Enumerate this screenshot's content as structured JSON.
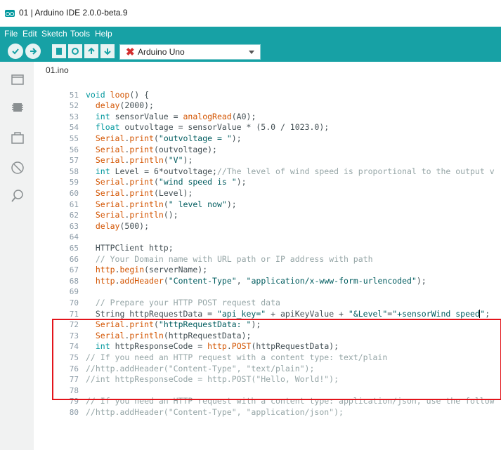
{
  "window": {
    "title": "01 | Arduino IDE 2.0.0-beta.9"
  },
  "menu": {
    "items": [
      "File",
      "Edit",
      "Sketch",
      "Tools",
      "Help"
    ]
  },
  "toolbar": {
    "board": "Arduino Uno"
  },
  "sidebar": {
    "icons": [
      "sketchbook-icon",
      "boards-manager-icon",
      "library-manager-icon",
      "debug-icon",
      "search-icon"
    ]
  },
  "editor": {
    "tab_name": "01.ino",
    "lines": [
      {
        "n": "51",
        "tokens": [
          {
            "t": "void",
            "c": "kw"
          },
          {
            "t": " "
          },
          {
            "t": "loop",
            "c": "fn"
          },
          {
            "t": "() {"
          }
        ]
      },
      {
        "n": "52",
        "tokens": [
          {
            "t": "  "
          },
          {
            "t": "delay",
            "c": "fn"
          },
          {
            "t": "(2000);"
          }
        ]
      },
      {
        "n": "53",
        "tokens": [
          {
            "t": "  "
          },
          {
            "t": "int",
            "c": "kw"
          },
          {
            "t": " sensorValue = "
          },
          {
            "t": "analogRead",
            "c": "fn"
          },
          {
            "t": "(A0);"
          }
        ]
      },
      {
        "n": "54",
        "tokens": [
          {
            "t": "  "
          },
          {
            "t": "float",
            "c": "kw"
          },
          {
            "t": " outvoltage = sensorValue * (5.0 / 1023.0);"
          }
        ]
      },
      {
        "n": "55",
        "tokens": [
          {
            "t": "  "
          },
          {
            "t": "Serial",
            "c": "fn"
          },
          {
            "t": "."
          },
          {
            "t": "print",
            "c": "fn"
          },
          {
            "t": "("
          },
          {
            "t": "\"outvoltage = \"",
            "c": "str"
          },
          {
            "t": ");"
          }
        ]
      },
      {
        "n": "56",
        "tokens": [
          {
            "t": "  "
          },
          {
            "t": "Serial",
            "c": "fn"
          },
          {
            "t": "."
          },
          {
            "t": "print",
            "c": "fn"
          },
          {
            "t": "(outvoltage);"
          }
        ]
      },
      {
        "n": "57",
        "tokens": [
          {
            "t": "  "
          },
          {
            "t": "Serial",
            "c": "fn"
          },
          {
            "t": "."
          },
          {
            "t": "println",
            "c": "fn"
          },
          {
            "t": "("
          },
          {
            "t": "\"V\"",
            "c": "str"
          },
          {
            "t": ");"
          }
        ]
      },
      {
        "n": "58",
        "tokens": [
          {
            "t": "  "
          },
          {
            "t": "int",
            "c": "kw"
          },
          {
            "t": " Level = 6*outvoltage;"
          },
          {
            "t": "//The level of wind speed is proportional to the output v",
            "c": "cm"
          }
        ]
      },
      {
        "n": "59",
        "tokens": [
          {
            "t": "  "
          },
          {
            "t": "Serial",
            "c": "fn"
          },
          {
            "t": "."
          },
          {
            "t": "print",
            "c": "fn"
          },
          {
            "t": "("
          },
          {
            "t": "\"wind speed is \"",
            "c": "str"
          },
          {
            "t": ");"
          }
        ]
      },
      {
        "n": "60",
        "tokens": [
          {
            "t": "  "
          },
          {
            "t": "Serial",
            "c": "fn"
          },
          {
            "t": "."
          },
          {
            "t": "print",
            "c": "fn"
          },
          {
            "t": "(Level);"
          }
        ]
      },
      {
        "n": "61",
        "tokens": [
          {
            "t": "  "
          },
          {
            "t": "Serial",
            "c": "fn"
          },
          {
            "t": "."
          },
          {
            "t": "println",
            "c": "fn"
          },
          {
            "t": "("
          },
          {
            "t": "\" level now\"",
            "c": "str"
          },
          {
            "t": ");"
          }
        ]
      },
      {
        "n": "62",
        "tokens": [
          {
            "t": "  "
          },
          {
            "t": "Serial",
            "c": "fn"
          },
          {
            "t": "."
          },
          {
            "t": "println",
            "c": "fn"
          },
          {
            "t": "();"
          }
        ]
      },
      {
        "n": "63",
        "tokens": [
          {
            "t": "  "
          },
          {
            "t": "delay",
            "c": "fn"
          },
          {
            "t": "(500);"
          }
        ]
      },
      {
        "n": "64",
        "tokens": []
      },
      {
        "n": "65",
        "tokens": [
          {
            "t": "  HTTPClient http;"
          }
        ]
      },
      {
        "n": "66",
        "tokens": [
          {
            "t": "  "
          },
          {
            "t": "// Your Domain name with URL path or IP address with path",
            "c": "cm"
          }
        ]
      },
      {
        "n": "67",
        "tokens": [
          {
            "t": "  "
          },
          {
            "t": "http",
            "c": "fn"
          },
          {
            "t": "."
          },
          {
            "t": "begin",
            "c": "fn"
          },
          {
            "t": "(serverName);"
          }
        ]
      },
      {
        "n": "68",
        "tokens": [
          {
            "t": "  "
          },
          {
            "t": "http",
            "c": "fn"
          },
          {
            "t": "."
          },
          {
            "t": "addHeader",
            "c": "fn"
          },
          {
            "t": "("
          },
          {
            "t": "\"Content-Type\"",
            "c": "str"
          },
          {
            "t": ", "
          },
          {
            "t": "\"application/x-www-form-urlencoded\"",
            "c": "str"
          },
          {
            "t": ");"
          }
        ]
      },
      {
        "n": "69",
        "tokens": []
      },
      {
        "n": "70",
        "tokens": [
          {
            "t": "  "
          },
          {
            "t": "// Prepare your HTTP POST request data",
            "c": "cm"
          }
        ]
      },
      {
        "n": "71",
        "tokens": [
          {
            "t": "  String httpRequestData = "
          },
          {
            "t": "\"api_key=\"",
            "c": "str"
          },
          {
            "t": " + apiKeyValue + "
          },
          {
            "t": "\"&Level\"",
            "c": "str"
          },
          {
            "t": "="
          },
          {
            "t": "\"+sensorWind speed",
            "c": "str"
          },
          {
            "t": "CARET",
            "c": "caret"
          },
          {
            "t": "\"",
            "c": "str"
          },
          {
            "t": ";"
          }
        ]
      },
      {
        "n": "72",
        "tokens": [
          {
            "t": "  "
          },
          {
            "t": "Serial",
            "c": "fn"
          },
          {
            "t": "."
          },
          {
            "t": "print",
            "c": "fn"
          },
          {
            "t": "("
          },
          {
            "t": "\"httpRequestData: \"",
            "c": "str"
          },
          {
            "t": ");"
          }
        ]
      },
      {
        "n": "73",
        "tokens": [
          {
            "t": "  "
          },
          {
            "t": "Serial",
            "c": "fn"
          },
          {
            "t": "."
          },
          {
            "t": "println",
            "c": "fn"
          },
          {
            "t": "(httpRequestData);"
          }
        ]
      },
      {
        "n": "74",
        "tokens": [
          {
            "t": "  "
          },
          {
            "t": "int",
            "c": "kw"
          },
          {
            "t": " httpResponseCode = "
          },
          {
            "t": "http",
            "c": "fn"
          },
          {
            "t": "."
          },
          {
            "t": "POST",
            "c": "fn"
          },
          {
            "t": "(httpRequestData);"
          }
        ]
      },
      {
        "n": "75",
        "tokens": [
          {
            "t": "// If you need an HTTP request with a content type: text/plain",
            "c": "cm"
          }
        ]
      },
      {
        "n": "76",
        "tokens": [
          {
            "t": "//http.addHeader(\"Content-Type\", \"text/plain\");",
            "c": "cm"
          }
        ]
      },
      {
        "n": "77",
        "tokens": [
          {
            "t": "//int httpResponseCode = http.POST(\"Hello, World!\");",
            "c": "cm"
          }
        ]
      },
      {
        "n": "78",
        "tokens": []
      },
      {
        "n": "79",
        "tokens": [
          {
            "t": "// If you need an HTTP request with a content type: application/json, use the follow",
            "c": "cm"
          }
        ]
      },
      {
        "n": "80",
        "tokens": [
          {
            "t": "//http.addHeader(\"Content-Type\", \"application/json\");",
            "c": "cm"
          }
        ]
      }
    ]
  },
  "colors": {
    "teal": "#17a1a5",
    "keyword": "#00979d",
    "function": "#d35400",
    "comment": "#95a5a6",
    "highlight_box": "#e3141b"
  }
}
